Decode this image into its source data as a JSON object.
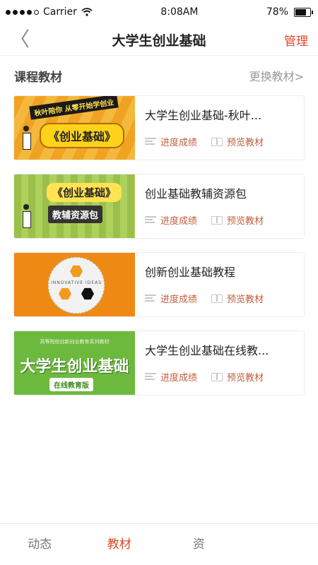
{
  "statusbar": {
    "carrier": "Carrier",
    "time": "8:08AM",
    "battery": "78%"
  },
  "navbar": {
    "back": "〈",
    "title": "大学生创业基础",
    "manage": "管理"
  },
  "section": {
    "title": "课程教材",
    "change": "更换教材>"
  },
  "books": [
    {
      "title": "大学生创业基础-秋叶...",
      "progress": "进度成绩",
      "preview": "预览教材",
      "cover": {
        "top": "秋叶陪你 从零开始学创业",
        "main": "《创业基础》"
      }
    },
    {
      "title": "创业基础教辅资源包",
      "progress": "进度成绩",
      "preview": "预览教材",
      "cover": {
        "main": "《创业基础》",
        "sub": "教辅资源包"
      }
    },
    {
      "title": "创新创业基础教程",
      "progress": "进度成绩",
      "preview": "预览教材",
      "cover": {
        "main": "INNOVATIVE IDEAS"
      }
    },
    {
      "title": "大学生创业基础在线教...",
      "progress": "进度成绩",
      "preview": "预览教材",
      "cover": {
        "top": "高等院校创新创业教育系列教材",
        "main": "大学生创业基础",
        "sub": "在线教育版"
      }
    }
  ],
  "tabs": [
    {
      "label": "动态",
      "active": false
    },
    {
      "label": "教材",
      "active": true
    },
    {
      "label": "资",
      "active": false
    },
    {
      "label": "",
      "active": false
    }
  ],
  "colors": {
    "accent": "#e04a2f",
    "tab_active": "#d94b2b"
  }
}
